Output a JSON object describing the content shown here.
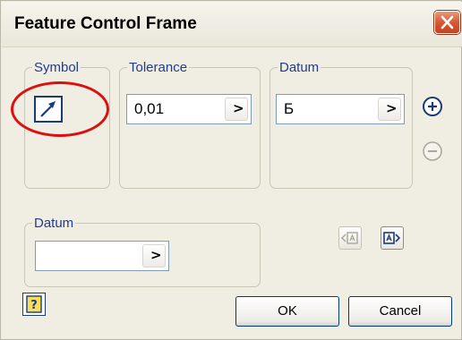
{
  "dialog": {
    "title": "Feature Control Frame",
    "close_icon": "close-x-icon"
  },
  "symbol_group": {
    "legend": "Symbol",
    "button_icon": "runout-arrow-icon",
    "highlight_color": "#dd1010"
  },
  "tolerance_group": {
    "legend": "Tolerance",
    "value": "0,01",
    "arrow": ">"
  },
  "datum_group": {
    "legend": "Datum",
    "value": "Б",
    "arrow": ">"
  },
  "datum_lower_group": {
    "legend": "Datum",
    "value": "",
    "arrow": ">"
  },
  "side_buttons": {
    "add_icon": "plus-circle-icon",
    "remove_icon": "minus-circle-icon"
  },
  "datum_nav": {
    "left_icon": "datum-left-icon",
    "right_icon": "datum-right-icon"
  },
  "footer": {
    "help_icon": "help-icon",
    "ok_label": "OK",
    "cancel_label": "Cancel"
  }
}
